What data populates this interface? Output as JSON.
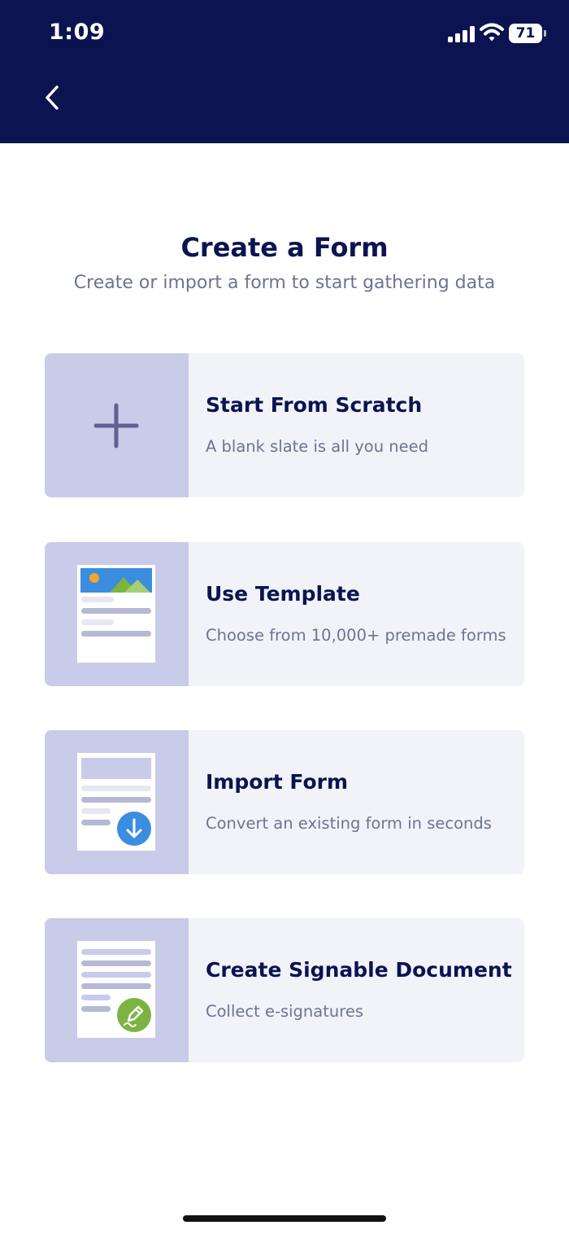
{
  "status_bar": {
    "time": "1:09",
    "battery": "71"
  },
  "header": {
    "back_icon": "chevron-left-icon"
  },
  "page": {
    "title": "Create a Form",
    "subtitle": "Create or import a form to start gathering data"
  },
  "options": [
    {
      "title": "Start From Scratch",
      "description": "A blank slate is all you need",
      "icon": "plus-icon"
    },
    {
      "title": "Use Template",
      "description": "Choose from 10,000+ premade forms",
      "icon": "template-icon"
    },
    {
      "title": "Import Form",
      "description": "Convert an existing form in seconds",
      "icon": "import-form-icon"
    },
    {
      "title": "Create Signable Document",
      "description": "Collect e-signatures",
      "icon": "signable-document-icon"
    }
  ],
  "colors": {
    "header_bg": "#0b1451",
    "title": "#0b1451",
    "subtitle": "#6d7394",
    "card_bg": "#f2f3f8",
    "icon_area_bg": "#c8cce9",
    "accent_blue": "#3b8de0",
    "accent_green": "#7cb342"
  }
}
